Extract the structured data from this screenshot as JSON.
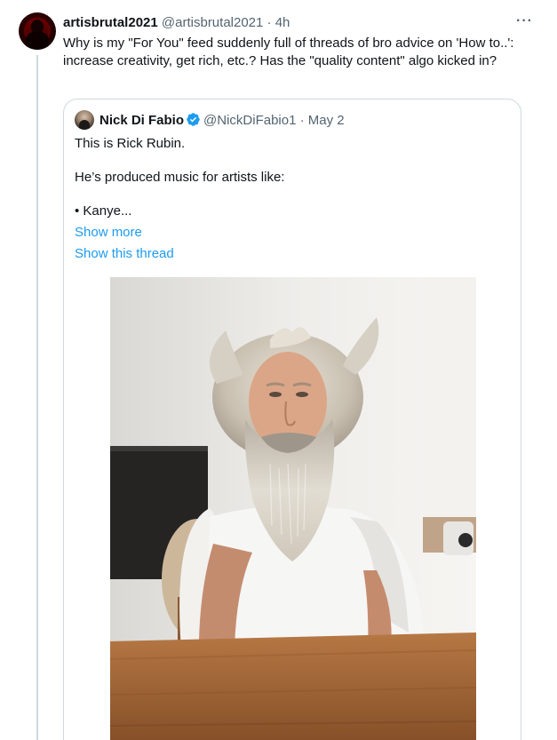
{
  "tweet": {
    "display_name": "artisbrutal2021",
    "handle": "@artisbrutal2021",
    "separator": "·",
    "time": "4h",
    "more_label": "···",
    "text": "Why is my \"For You\" feed suddenly full of threads of bro advice on  'How to..': increase creativity, get rich, etc.?  Has the \"quality content\" algo kicked in?"
  },
  "quote": {
    "display_name": "Nick Di Fabio",
    "handle": "@NickDiFabio1",
    "separator": "·",
    "date": "May 2",
    "lines": [
      "This is Rick Rubin.",
      "",
      "He’s produced music for artists like:",
      "",
      "• Kanye..."
    ],
    "show_more": "Show more",
    "show_thread": "Show this thread",
    "photo_icon": "photo-of-bearded-man"
  },
  "colors": {
    "link": "#1d9bf0",
    "secondary_text": "#536471",
    "border": "#cfd9de",
    "verified": "#1d9bf0"
  }
}
